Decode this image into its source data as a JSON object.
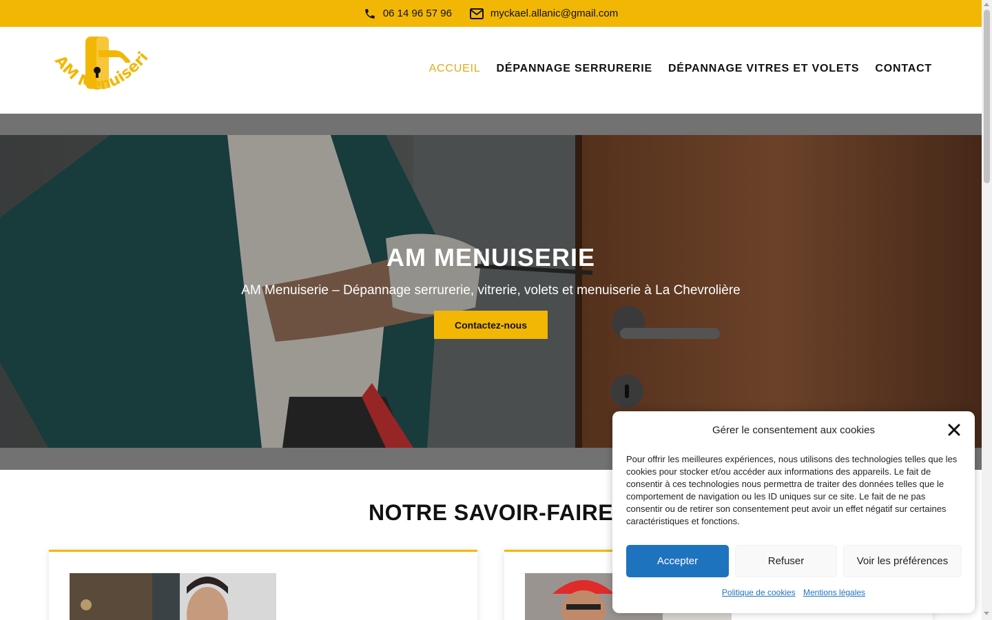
{
  "topbar": {
    "phone": "06 14 96 57 96",
    "email": "myckael.allanic@gmail.com",
    "phone_icon": "phone-icon",
    "email_icon": "envelope-icon",
    "background": "#f2b705"
  },
  "header": {
    "logo_text": "AM Menuiserie",
    "nav": [
      {
        "label": "ACCUEIL",
        "active": true
      },
      {
        "label": "DÉPANNAGE SERRURERIE",
        "active": false
      },
      {
        "label": "DÉPANNAGE VITRES ET VOLETS",
        "active": false
      },
      {
        "label": "CONTACT",
        "active": false
      }
    ]
  },
  "hero": {
    "title": "AM MENUISERIE",
    "subtitle": "AM Menuiserie – Dépannage serrurerie, vitrerie, volets et menuiserie à La Chevrolière",
    "button_label": "Contactez-nous"
  },
  "section": {
    "title": "NOTRE SAVOIR-FAIRE"
  },
  "cookie_banner": {
    "title": "Gérer le consentement aux cookies",
    "text": "Pour offrir les meilleures expériences, nous utilisons des technologies telles que les cookies pour stocker et/ou accéder aux informations des appareils. Le fait de consentir à ces technologies nous permettra de traiter des données telles que le comportement de navigation ou les ID uniques sur ce site. Le fait de ne pas consentir ou de retirer son consentement peut avoir un effet négatif sur certaines caractéristiques et fonctions.",
    "accept_label": "Accepter",
    "refuse_label": "Refuser",
    "preferences_label": "Voir les préférences",
    "cookie_policy_link": "Politique de cookies",
    "legal_link": "Mentions légales",
    "accent": "#1e73be"
  },
  "colors": {
    "brand_yellow": "#f2b705",
    "nav_active": "#e3aa12",
    "text_dark": "#111111"
  }
}
